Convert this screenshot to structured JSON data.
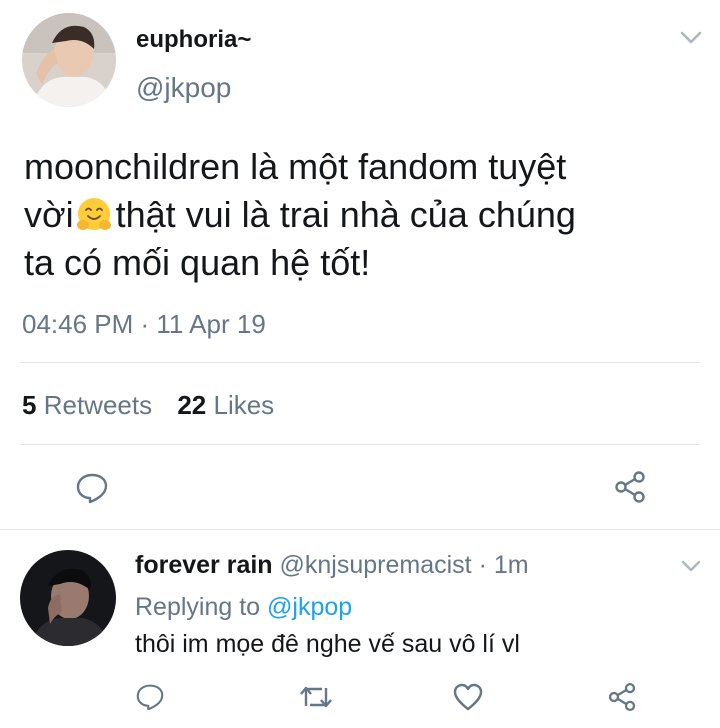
{
  "main_tweet": {
    "display_name": "euphoria~",
    "handle": "@jkpop",
    "text_line1": "moonchildren là một fandom tuyệt",
    "text_line2a": "vời",
    "emoji_icon": "hugging-face-emoji",
    "text_line2b": "thật vui là trai nhà của chúng",
    "text_line3": "ta có mối quan hệ tốt!",
    "timestamp": "04:46 PM · 11 Apr 19",
    "retweets_count": "5",
    "retweets_label": "Retweets",
    "likes_count": "22",
    "likes_label": "Likes",
    "actions": [
      "reply-icon",
      "share-icon"
    ]
  },
  "reply_tweet": {
    "display_name": "forever rain",
    "handle": "@knjsupremacist",
    "separator": "·",
    "time": "1m",
    "replying_prefix": "Replying to",
    "replying_handle": "@jkpop",
    "text": "thôi im mọe đê nghe vế sau vô lí vl",
    "actions": [
      "reply-icon",
      "retweet-icon",
      "like-icon",
      "share-icon"
    ]
  },
  "colors": {
    "link": "#1da1f2",
    "muted": "#657786",
    "divider": "#e1e8ed",
    "icon": "#657786"
  }
}
